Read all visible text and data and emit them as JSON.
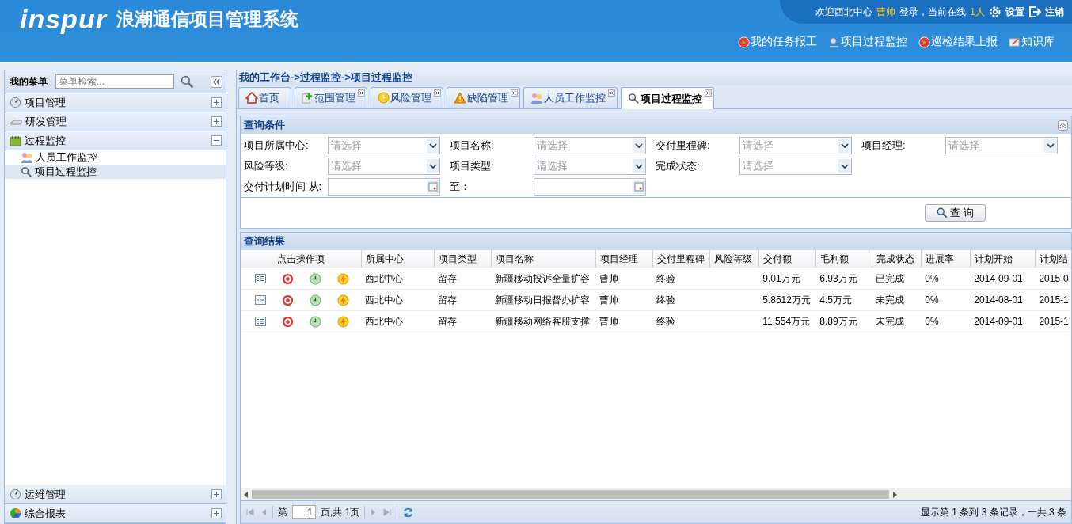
{
  "header": {
    "logo": "inspur",
    "title": "浪潮通信项目管理系统",
    "welcome": "欢迎西北中心",
    "user": "曹帅",
    "login_text": "登录，当前在线",
    "online": "1人",
    "settings": "设置",
    "logout": "注销"
  },
  "nav": [
    {
      "label": "我的任务报工",
      "kind": "play"
    },
    {
      "label": "项目过程监控",
      "kind": "monitor"
    },
    {
      "label": "巡检结果上报",
      "kind": "play"
    },
    {
      "label": "知识库",
      "kind": "note"
    }
  ],
  "sidebar": {
    "title": "我的菜单",
    "search_placeholder": "菜单检索...",
    "groups": [
      {
        "label": "项目管理",
        "kind": "gauge",
        "expanded": false
      },
      {
        "label": "研发管理",
        "kind": "device",
        "expanded": false
      },
      {
        "label": "过程监控",
        "kind": "calendar",
        "expanded": true,
        "children": [
          {
            "label": "人员工作监控",
            "kind": "people",
            "selected": false
          },
          {
            "label": "项目过程监控",
            "kind": "search",
            "selected": true
          }
        ]
      }
    ],
    "bottom_groups": [
      {
        "label": "运维管理",
        "kind": "gauge",
        "expanded": false
      },
      {
        "label": "综合报表",
        "kind": "pie",
        "expanded": false
      }
    ]
  },
  "breadcrumb": "我的工作台->过程监控->项目过程监控",
  "tabs": [
    {
      "label": "首页",
      "kind": "home",
      "closable": false,
      "selected": false
    },
    {
      "label": "范围管理",
      "kind": "plus",
      "closable": true,
      "selected": false
    },
    {
      "label": "风险管理",
      "kind": "clock",
      "closable": true,
      "selected": false
    },
    {
      "label": "缺陷管理",
      "kind": "warning",
      "closable": true,
      "selected": false
    },
    {
      "label": "人员工作监控",
      "kind": "people",
      "closable": true,
      "selected": false
    },
    {
      "label": "项目过程监控",
      "kind": "search",
      "closable": true,
      "selected": true
    }
  ],
  "query": {
    "title": "查询条件",
    "rows": [
      [
        {
          "label": "项目所属中心:",
          "kind": "select",
          "placeholder": "请选择"
        },
        {
          "label": "项目名称:",
          "kind": "select",
          "placeholder": "请选择"
        },
        {
          "label": "交付里程碑:",
          "kind": "select",
          "placeholder": "请选择"
        },
        {
          "label": "项目经理:",
          "kind": "select",
          "placeholder": "请选择"
        }
      ],
      [
        {
          "label": "风险等级:",
          "kind": "select",
          "placeholder": "请选择"
        },
        {
          "label": "项目类型:",
          "kind": "select",
          "placeholder": "请选择"
        },
        {
          "label": "完成状态:",
          "kind": "select",
          "placeholder": "请选择"
        }
      ],
      [
        {
          "label": "交付计划时间 从:",
          "kind": "date"
        },
        {
          "label": "至：",
          "kind": "date"
        }
      ]
    ],
    "button": "查 询"
  },
  "results": {
    "title": "查询结果",
    "action_header": "点击操作项",
    "columns": [
      "所属中心",
      "项目类型",
      "项目名称",
      "项目经理",
      "交付里程碑",
      "风险等级",
      "交付额",
      "毛利额",
      "完成状态",
      "进展率",
      "计划开始",
      "计划结"
    ],
    "rows": [
      [
        "西北中心",
        "留存",
        "新疆移动投诉全量扩容",
        "曹帅",
        "终验",
        "",
        "9.01万元",
        "6.93万元",
        "已完成",
        "0%",
        "2014-09-01",
        "2015-0"
      ],
      [
        "西北中心",
        "留存",
        "新疆移动日报督办扩容",
        "曹帅",
        "终验",
        "",
        "5.8512万元",
        "4.5万元",
        "未完成",
        "0%",
        "2014-08-01",
        "2015-1"
      ],
      [
        "西北中心",
        "留存",
        "新疆移动网络客服支撑",
        "曹帅",
        "终验",
        "",
        "11.554万元",
        "8.89万元",
        "未完成",
        "0%",
        "2014-09-01",
        "2015-1"
      ]
    ]
  },
  "pager": {
    "page_label": "第",
    "page": "1",
    "total_label": "页,共 1页",
    "summary": "显示第 1 条到 3 条记录，一共 3 条"
  }
}
